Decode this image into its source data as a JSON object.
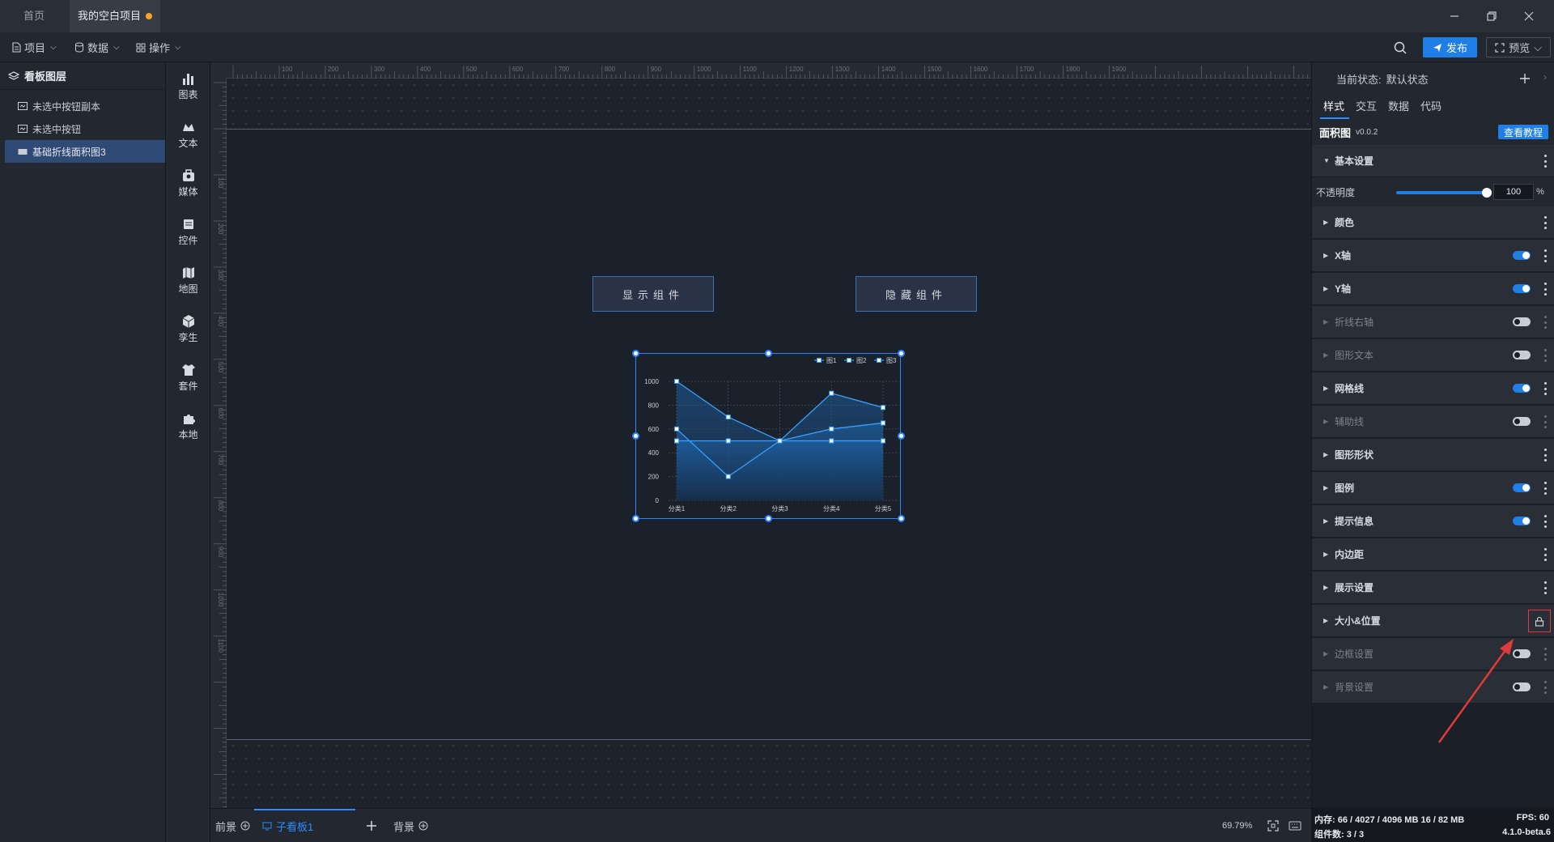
{
  "tabs": {
    "home": "首页",
    "project": "我的空白项目"
  },
  "menu": {
    "project": "项目",
    "data": "数据",
    "operate": "操作",
    "publish": "发布",
    "preview": "预览"
  },
  "layers": {
    "title": "看板图层",
    "items": [
      {
        "label": "未选中按钮副本",
        "selected": false
      },
      {
        "label": "未选中按钮",
        "selected": false
      },
      {
        "label": "基础折线面积图3",
        "selected": true
      }
    ]
  },
  "tools": [
    {
      "label": "图表",
      "icon": "bar-chart-icon"
    },
    {
      "label": "文本",
      "icon": "text-icon"
    },
    {
      "label": "媒体",
      "icon": "media-icon"
    },
    {
      "label": "控件",
      "icon": "widget-icon"
    },
    {
      "label": "地图",
      "icon": "map-icon"
    },
    {
      "label": "孪生",
      "icon": "cube-icon"
    },
    {
      "label": "套件",
      "icon": "suite-icon"
    },
    {
      "label": "本地",
      "icon": "puzzle-icon"
    }
  ],
  "ruler": {
    "top": [
      "100",
      "200",
      "300",
      "400",
      "500",
      "600",
      "700",
      "800",
      "900",
      "1000",
      "1100",
      "1200",
      "1300",
      "1400",
      "1500",
      "1600",
      "1700",
      "1800",
      "1900"
    ],
    "left": [
      "100",
      "200",
      "300",
      "400",
      "500",
      "600",
      "700",
      "800",
      "900",
      "1000",
      "1100"
    ]
  },
  "stage": {
    "show_button": "显示组件",
    "hide_button": "隐藏组件"
  },
  "chart_data": {
    "type": "area",
    "categories": [
      "分类1",
      "分类2",
      "分类3",
      "分类4",
      "分类5"
    ],
    "series": [
      {
        "name": "图1",
        "values": [
          1000,
          700,
          500,
          900,
          780
        ]
      },
      {
        "name": "图2",
        "values": [
          600,
          200,
          500,
          600,
          650
        ]
      },
      {
        "name": "图3",
        "values": [
          500,
          500,
          500,
          500,
          500
        ]
      }
    ],
    "ylim": [
      0,
      1000
    ],
    "yticks": [
      "0",
      "200",
      "400",
      "600",
      "800",
      "1000"
    ],
    "grid": true,
    "legend": "top-right",
    "colors": {
      "line": "#3aa0ff",
      "area_top": "#1f6cb8",
      "area_bottom": "#15304f"
    }
  },
  "bottom": {
    "foreground": "前景",
    "sub_board": "子看板1",
    "background": "背景",
    "zoom": "69.79%"
  },
  "right": {
    "state_label": "当前状态:",
    "state_value": "默认状态",
    "tabs": [
      "样式",
      "交互",
      "数据",
      "代码"
    ],
    "component_name": "面积图",
    "component_version": "v0.0.2",
    "tutorial": "查看教程",
    "basic": "基本设置",
    "opacity_label": "不透明度",
    "opacity_value": "100",
    "opacity_unit": "%",
    "sections": [
      {
        "label": "颜色",
        "toggle": null,
        "dim": false
      },
      {
        "label": "X轴",
        "toggle": true,
        "dim": false
      },
      {
        "label": "Y轴",
        "toggle": true,
        "dim": false
      },
      {
        "label": "折线右轴",
        "toggle": false,
        "dim": true
      },
      {
        "label": "图形文本",
        "toggle": false,
        "dim": true
      },
      {
        "label": "网格线",
        "toggle": true,
        "dim": false
      },
      {
        "label": "辅助线",
        "toggle": false,
        "dim": true
      },
      {
        "label": "图形形状",
        "toggle": null,
        "dim": false
      },
      {
        "label": "图例",
        "toggle": true,
        "dim": false
      },
      {
        "label": "提示信息",
        "toggle": true,
        "dim": false
      },
      {
        "label": "内边距",
        "toggle": null,
        "dim": false
      },
      {
        "label": "展示设置",
        "toggle": null,
        "dim": false
      },
      {
        "label": "大小&位置",
        "toggle": "lock",
        "dim": false
      },
      {
        "label": "边框设置",
        "toggle": false,
        "dim": true
      },
      {
        "label": "背景设置",
        "toggle": false,
        "dim": true
      }
    ]
  },
  "status": {
    "memory": "内存: 66 / 4027 / 4096 MB 16 / 82 MB",
    "fps": "FPS: 60",
    "components": "组件数: 3 / 3",
    "version": "4.1.0-beta.6"
  },
  "colors": {
    "accent": "#1f7fe6",
    "highlight": "#e03a3a"
  }
}
